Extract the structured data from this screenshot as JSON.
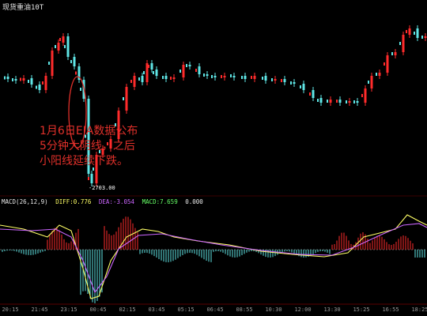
{
  "window": {
    "title": "现货重油10T"
  },
  "annotation": {
    "lines": [
      "1月6日EIA数据公布",
      "5分钟大阴线，之后",
      "小阳线延续下跌。"
    ]
  },
  "low_label": "-2703.00",
  "macd": {
    "label": "MACD(26,12,9)",
    "diff": "DIFF:0.776",
    "dea": "DEA:-3.054",
    "macd": "MACD:7.659",
    "extra": "0.000",
    "colors": {
      "diff": "#ffff66",
      "dea": "#cc66ff",
      "macd": "#66ff66",
      "label": "#e8e8e8"
    }
  },
  "time_axis": [
    "20:15",
    "21:45",
    "23:15",
    "00:45",
    "02:15",
    "03:45",
    "05:15",
    "06:45",
    "08:55",
    "10:30",
    "12:00",
    "13:30",
    "15:25",
    "16:55",
    "18:25"
  ],
  "colors": {
    "up": "#ff2b2b",
    "down": "#5fe6e6",
    "bg": "#000000",
    "annotation": "#e0302a"
  }
}
